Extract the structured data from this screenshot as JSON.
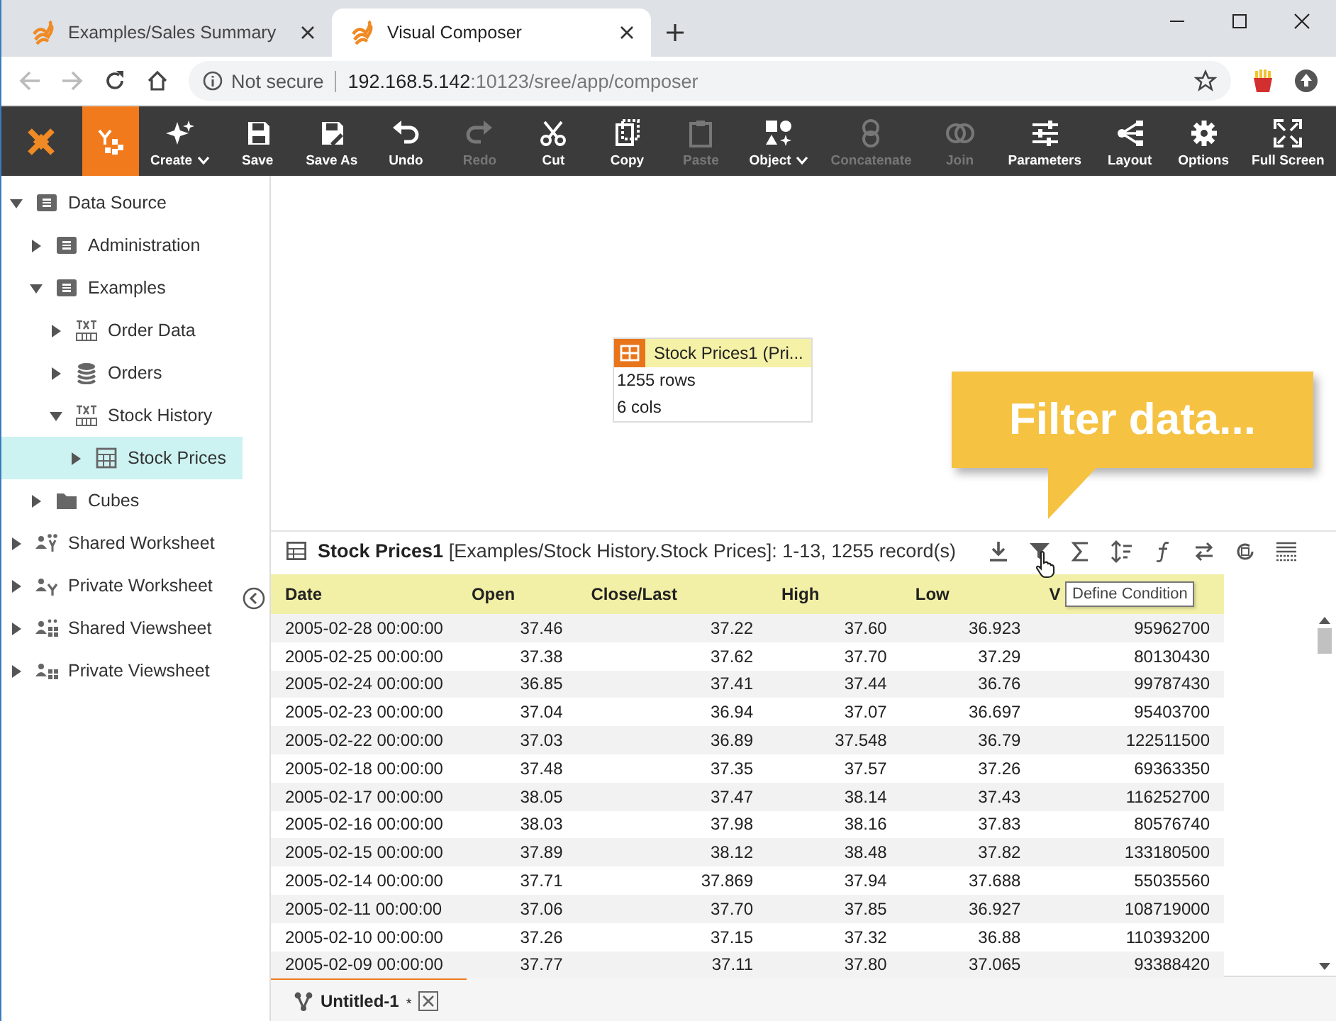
{
  "browser": {
    "tabs": [
      {
        "title": "Examples/Sales Summary",
        "selected": false
      },
      {
        "title": "Visual Composer",
        "selected": true
      }
    ],
    "address": {
      "security": "Not secure",
      "host": "192.168.5.142",
      "path": ":10123/sree/app/composer"
    }
  },
  "toolbar": {
    "home_selected": true,
    "buttons": [
      {
        "label": "Create",
        "dropdown": true,
        "disabled": false
      },
      {
        "label": "Save",
        "dropdown": false,
        "disabled": false
      },
      {
        "label": "Save As",
        "dropdown": false,
        "disabled": false
      },
      {
        "label": "Undo",
        "dropdown": false,
        "disabled": false
      },
      {
        "label": "Redo",
        "dropdown": false,
        "disabled": true
      },
      {
        "label": "Cut",
        "dropdown": false,
        "disabled": false
      },
      {
        "label": "Copy",
        "dropdown": false,
        "disabled": false
      },
      {
        "label": "Paste",
        "dropdown": false,
        "disabled": true
      },
      {
        "label": "Object",
        "dropdown": true,
        "disabled": false
      },
      {
        "label": "Concatenate",
        "dropdown": false,
        "disabled": true
      },
      {
        "label": "Join",
        "dropdown": false,
        "disabled": true
      },
      {
        "label": "Parameters",
        "dropdown": false,
        "disabled": false
      },
      {
        "label": "Layout",
        "dropdown": false,
        "disabled": false
      },
      {
        "label": "Options",
        "dropdown": false,
        "disabled": false
      },
      {
        "label": "Full Screen",
        "dropdown": false,
        "disabled": false
      }
    ]
  },
  "sidebar": {
    "items": [
      {
        "label": "Data Source",
        "kind": "datasource",
        "expanded": true,
        "selected": false,
        "children": [
          {
            "label": "Administration",
            "kind": "datasource",
            "expanded": false,
            "selected": false
          },
          {
            "label": "Examples",
            "kind": "datasource",
            "expanded": true,
            "selected": false,
            "children": [
              {
                "label": "Order Data",
                "kind": "text",
                "expanded": false,
                "selected": false
              },
              {
                "label": "Orders",
                "kind": "database",
                "expanded": false,
                "selected": false
              },
              {
                "label": "Stock History",
                "kind": "text",
                "expanded": true,
                "selected": false,
                "children": [
                  {
                    "label": "Stock Prices",
                    "kind": "table",
                    "expanded": false,
                    "selected": true
                  }
                ]
              }
            ]
          },
          {
            "label": "Cubes",
            "kind": "folder",
            "expanded": false,
            "selected": false
          }
        ]
      },
      {
        "label": "Shared Worksheet",
        "kind": "shared-worksheet",
        "expanded": false,
        "selected": false
      },
      {
        "label": "Private Worksheet",
        "kind": "private-worksheet",
        "expanded": false,
        "selected": false
      },
      {
        "label": "Shared Viewsheet",
        "kind": "shared-viewsheet",
        "expanded": false,
        "selected": false
      },
      {
        "label": "Private Viewsheet",
        "kind": "private-viewsheet",
        "expanded": false,
        "selected": false
      }
    ]
  },
  "canvas": {
    "node": {
      "title": "Stock Prices1 (Pri...",
      "lines": [
        "1255 rows",
        "6 cols"
      ]
    },
    "callout": "Filter data..."
  },
  "data_pane": {
    "title": "**Stock Prices1** [Examples/Stock History.Stock Prices]: 1-13, 1255 record(s)",
    "tooltip": "Define Condition",
    "table": {
      "columns": [
        "Date",
        "Open",
        "Close/Last",
        "High",
        "Low",
        "V"
      ],
      "rows": [
        [
          "2005-02-28 00:00:00",
          "37.46",
          "37.22",
          "37.60",
          "36.923",
          "95962700"
        ],
        [
          "2005-02-25 00:00:00",
          "37.38",
          "37.62",
          "37.70",
          "37.29",
          "80130430"
        ],
        [
          "2005-02-24 00:00:00",
          "36.85",
          "37.41",
          "37.44",
          "36.76",
          "99787430"
        ],
        [
          "2005-02-23 00:00:00",
          "37.04",
          "36.94",
          "37.07",
          "36.697",
          "95403700"
        ],
        [
          "2005-02-22 00:00:00",
          "37.03",
          "36.89",
          "37.548",
          "36.79",
          "122511500"
        ],
        [
          "2005-02-18 00:00:00",
          "37.48",
          "37.35",
          "37.57",
          "37.26",
          "69363350"
        ],
        [
          "2005-02-17 00:00:00",
          "38.05",
          "37.47",
          "38.14",
          "37.43",
          "116252700"
        ],
        [
          "2005-02-16 00:00:00",
          "38.03",
          "37.98",
          "38.16",
          "37.83",
          "80576740"
        ],
        [
          "2005-02-15 00:00:00",
          "37.89",
          "38.12",
          "38.48",
          "37.82",
          "133180500"
        ],
        [
          "2005-02-14 00:00:00",
          "37.71",
          "37.869",
          "37.94",
          "37.688",
          "55035560"
        ],
        [
          "2005-02-11 00:00:00",
          "37.06",
          "37.70",
          "37.85",
          "36.927",
          "108719000"
        ],
        [
          "2005-02-10 00:00:00",
          "37.26",
          "37.15",
          "37.32",
          "36.88",
          "110393200"
        ],
        [
          "2005-02-09 00:00:00",
          "37.77",
          "37.11",
          "37.80",
          "37.065",
          "93388420"
        ]
      ]
    }
  },
  "bottom_tabs": [
    {
      "title": "Untitled-1",
      "modified_mark": "*",
      "selected": true
    }
  ]
}
